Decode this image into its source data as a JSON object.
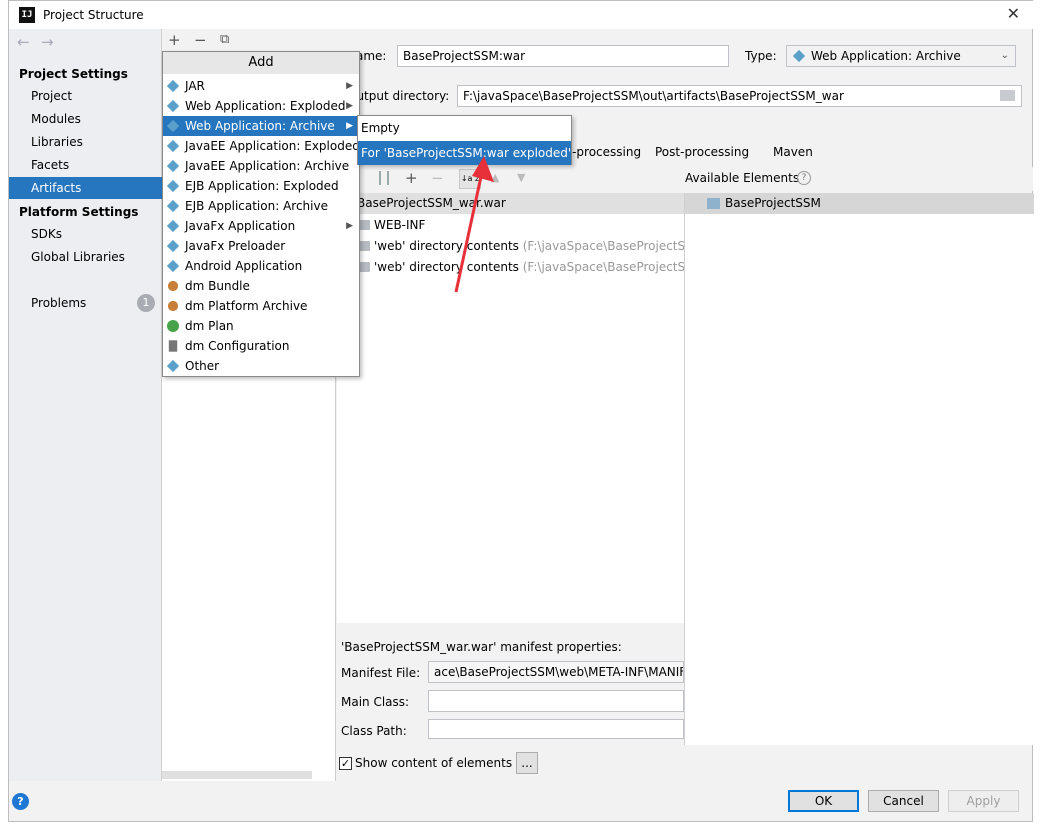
{
  "window": {
    "title": "Project Structure",
    "app_icon": "IJ"
  },
  "nav": {
    "back": "←",
    "forward": "→"
  },
  "sidebar": {
    "project_settings": "Project Settings",
    "items": [
      {
        "label": "Project"
      },
      {
        "label": "Modules"
      },
      {
        "label": "Libraries"
      },
      {
        "label": "Facets"
      },
      {
        "label": "Artifacts",
        "selected": true
      }
    ],
    "platform_settings": "Platform Settings",
    "platform_items": [
      {
        "label": "SDKs"
      },
      {
        "label": "Global Libraries"
      }
    ],
    "problems": {
      "label": "Problems",
      "count": "1"
    }
  },
  "list_toolbar": {
    "add": "+",
    "remove": "−",
    "copy": "⧉"
  },
  "artifact": {
    "name_label": "Name:",
    "name_value": "BaseProjectSSM:war",
    "type_label": "Type:",
    "type_value": "Web Application: Archive",
    "output_label": "Output directory:",
    "output_value": "F:\\javaSpace\\BaseProjectSSM\\out\\artifacts\\BaseProjectSSM_war"
  },
  "tabs": [
    {
      "label": "Pre-processing"
    },
    {
      "label": "Post-processing"
    },
    {
      "label": "Maven"
    }
  ],
  "layout_toolbar": {
    "sort": "↓a z",
    "add": "+",
    "remove": "−",
    "up": "▲",
    "down": "▼"
  },
  "output_tree": {
    "root": "BaseProjectSSM_war.war",
    "nodes": [
      {
        "label": "WEB-INF",
        "path": ""
      },
      {
        "label": "'web' directory contents",
        "path": " (F:\\javaSpace\\BaseProjectSSM\\web)"
      },
      {
        "label": "'web' directory contents",
        "path": " (F:\\javaSpace\\BaseProjectSSM\\web)"
      }
    ]
  },
  "available": {
    "label": "Available Elements",
    "help": "?",
    "root": "BaseProjectSSM"
  },
  "manifest": {
    "title": "'BaseProjectSSM_war.war' manifest properties:",
    "file_label": "Manifest File:",
    "file_value": "ace\\BaseProjectSSM\\web\\META-INF\\MANIFEST.MF",
    "main_class_label": "Main Class:",
    "main_class_value": "",
    "class_path_label": "Class Path:",
    "class_path_value": ""
  },
  "show_content": {
    "label": "Show content of elements",
    "checked": true,
    "more": "..."
  },
  "buttons": {
    "ok": "OK",
    "cancel": "Cancel",
    "apply": "Apply"
  },
  "add_menu": {
    "header": "Add",
    "items": [
      {
        "label": "JAR",
        "icon": "diamond-icon",
        "submenu": true
      },
      {
        "label": "Web Application: Exploded",
        "icon": "diamond-icon",
        "submenu": true
      },
      {
        "label": "Web Application: Archive",
        "icon": "diamond-icon",
        "submenu": true,
        "selected": true
      },
      {
        "label": "JavaEE Application: Exploded",
        "icon": "diamond-icon"
      },
      {
        "label": "JavaEE Application: Archive",
        "icon": "diamond-icon"
      },
      {
        "label": "EJB Application: Exploded",
        "icon": "diamond-icon"
      },
      {
        "label": "EJB Application: Archive",
        "icon": "diamond-icon"
      },
      {
        "label": "JavaFx Application",
        "icon": "diamond-icon",
        "submenu": true
      },
      {
        "label": "JavaFx Preloader",
        "icon": "diamond-icon"
      },
      {
        "label": "Android Application",
        "icon": "diamond-icon"
      },
      {
        "label": "dm Bundle",
        "icon": "dm-icon"
      },
      {
        "label": "dm Platform Archive",
        "icon": "dm-icon"
      },
      {
        "label": "dm Plan",
        "icon": "plan-icon"
      },
      {
        "label": "dm Configuration",
        "icon": "file-icon"
      },
      {
        "label": "Other",
        "icon": "diamond-icon"
      }
    ]
  },
  "submenu": {
    "items": [
      {
        "label": "Empty"
      },
      {
        "label": "For 'BaseProjectSSM:war exploded'",
        "selected": true
      }
    ]
  },
  "colors": {
    "selection": "#2675bf",
    "arrow": "#e8303a"
  }
}
